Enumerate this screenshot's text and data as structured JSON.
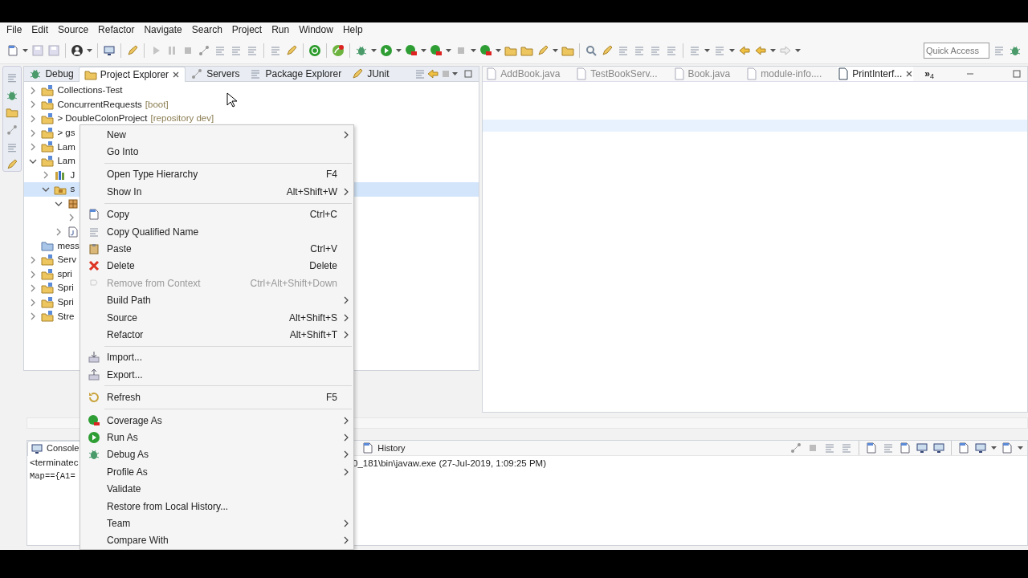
{
  "menubar": [
    "File",
    "Edit",
    "Source",
    "Refactor",
    "Navigate",
    "Search",
    "Project",
    "Run",
    "Window",
    "Help"
  ],
  "toolbar": {
    "quick_access": {
      "placeholder": "Quick Access"
    }
  },
  "left_view": {
    "tabs": [
      {
        "label": "Debug",
        "selected": false,
        "closable": false
      },
      {
        "label": "Project Explorer",
        "selected": true,
        "closable": true
      },
      {
        "label": "Servers",
        "selected": false,
        "closable": false
      },
      {
        "label": "Package Explorer",
        "selected": false,
        "closable": false
      },
      {
        "label": "JUnit",
        "selected": false,
        "closable": false
      }
    ],
    "tree": [
      {
        "label": "Collections-Test",
        "kind": "project",
        "expandable": true,
        "expanded": false,
        "selected": false
      },
      {
        "label": "ConcurrentRequests",
        "decoration": "[boot]",
        "kind": "project",
        "expandable": true,
        "expanded": false,
        "selected": false
      },
      {
        "label": "> DoubleColonProject",
        "decoration": "[repository dev]",
        "kind": "project",
        "expandable": true,
        "expanded": false,
        "selected": false
      },
      {
        "label": "> gs",
        "kind": "project",
        "expandable": true,
        "expanded": false,
        "selected": false
      },
      {
        "label": "Lam",
        "kind": "project",
        "expandable": true,
        "expanded": false,
        "selected": false
      },
      {
        "label": "Lam",
        "kind": "project",
        "expandable": true,
        "expanded": true,
        "selected": false,
        "children": [
          {
            "label": "J",
            "kind": "library",
            "expandable": true,
            "expanded": false,
            "selected": false
          },
          {
            "label": "s",
            "kind": "source-folder",
            "expandable": true,
            "expanded": true,
            "selected": true,
            "children": [
              {
                "kind": "package",
                "expandable": true,
                "expanded": true,
                "selected": false,
                "children": [
                  {
                    "expandable": true,
                    "expanded": false,
                    "selected": false
                  }
                ]
              },
              {
                "kind": "file",
                "expandable": true,
                "expanded": false,
                "selected": false
              }
            ]
          }
        ]
      },
      {
        "label": "mess",
        "kind": "folder",
        "expandable": false,
        "selected": false
      },
      {
        "label": "Serv",
        "kind": "project",
        "expandable": true,
        "expanded": false,
        "selected": false
      },
      {
        "label": "spri",
        "kind": "project",
        "expandable": true,
        "expanded": false,
        "selected": false
      },
      {
        "label": "Spri",
        "kind": "project",
        "expandable": true,
        "expanded": false,
        "selected": false
      },
      {
        "label": "Spri",
        "kind": "project",
        "expandable": true,
        "expanded": false,
        "selected": false
      },
      {
        "label": "Stre",
        "kind": "project",
        "expandable": true,
        "expanded": false,
        "selected": false
      }
    ]
  },
  "editor": {
    "tabs": [
      {
        "label": "AddBook.java",
        "selected": false
      },
      {
        "label": "TestBookServ...",
        "selected": false
      },
      {
        "label": "Book.java",
        "selected": false
      },
      {
        "label": "module-info....",
        "selected": false
      },
      {
        "label": "PrintInterf...",
        "selected": true
      }
    ],
    "overflow": "»",
    "overflow_count": "4"
  },
  "console": {
    "tabs": [
      {
        "label": "Console",
        "selected": true
      },
      {
        "label": "History",
        "selected": false
      }
    ],
    "lines": [
      [
        "<terminatec",
        "0_181\\bin\\javaw.exe (27-Jul-2019, 1:09:25 PM)"
      ],
      [
        "Map=={A1="
      ]
    ]
  },
  "context_menu": {
    "items": [
      {
        "kind": "plain",
        "label": "New",
        "submenu": true,
        "disabled": false
      },
      {
        "kind": "plain",
        "label": "Go Into",
        "submenu": false,
        "disabled": false
      },
      {
        "kind": "separator"
      },
      {
        "kind": "plain",
        "label": "Open Type Hierarchy",
        "shortcut": "F4",
        "submenu": false,
        "disabled": false
      },
      {
        "kind": "plain",
        "label": "Show In",
        "shortcut": "Alt+Shift+W",
        "submenu": true,
        "disabled": false
      },
      {
        "kind": "separator"
      },
      {
        "kind": "copy",
        "label": "Copy",
        "shortcut": "Ctrl+C",
        "submenu": false,
        "disabled": false
      },
      {
        "kind": "copy-name",
        "label": "Copy Qualified Name",
        "submenu": false,
        "disabled": false
      },
      {
        "kind": "paste",
        "label": "Paste",
        "shortcut": "Ctrl+V",
        "submenu": false,
        "disabled": false
      },
      {
        "kind": "delete",
        "label": "Delete",
        "shortcut": "Delete",
        "submenu": false,
        "disabled": false
      },
      {
        "kind": "remove",
        "label": "Remove from Context",
        "shortcut": "Ctrl+Alt+Shift+Down",
        "submenu": false,
        "disabled": true
      },
      {
        "kind": "plain",
        "label": "Build Path",
        "submenu": true,
        "disabled": false
      },
      {
        "kind": "plain",
        "label": "Source",
        "shortcut": "Alt+Shift+S",
        "submenu": true,
        "disabled": false
      },
      {
        "kind": "plain",
        "label": "Refactor",
        "shortcut": "Alt+Shift+T",
        "submenu": true,
        "disabled": false
      },
      {
        "kind": "separator"
      },
      {
        "kind": "import",
        "label": "Import...",
        "submenu": false,
        "disabled": false
      },
      {
        "kind": "export",
        "label": "Export...",
        "submenu": false,
        "disabled": false
      },
      {
        "kind": "separator"
      },
      {
        "kind": "refresh",
        "label": "Refresh",
        "shortcut": "F5",
        "submenu": false,
        "disabled": false
      },
      {
        "kind": "separator"
      },
      {
        "kind": "coverage",
        "label": "Coverage As",
        "submenu": true,
        "disabled": false
      },
      {
        "kind": "run",
        "label": "Run As",
        "submenu": true,
        "disabled": false
      },
      {
        "kind": "debug",
        "label": "Debug As",
        "submenu": true,
        "disabled": false
      },
      {
        "kind": "plain",
        "label": "Profile As",
        "submenu": true,
        "disabled": false
      },
      {
        "kind": "plain",
        "label": "Validate",
        "submenu": false,
        "disabled": false
      },
      {
        "kind": "plain",
        "label": "Restore from Local History...",
        "submenu": false,
        "disabled": false
      },
      {
        "kind": "plain",
        "label": "Team",
        "submenu": true,
        "disabled": false
      },
      {
        "kind": "plain",
        "label": "Compare With",
        "submenu": true,
        "disabled": false
      }
    ]
  }
}
